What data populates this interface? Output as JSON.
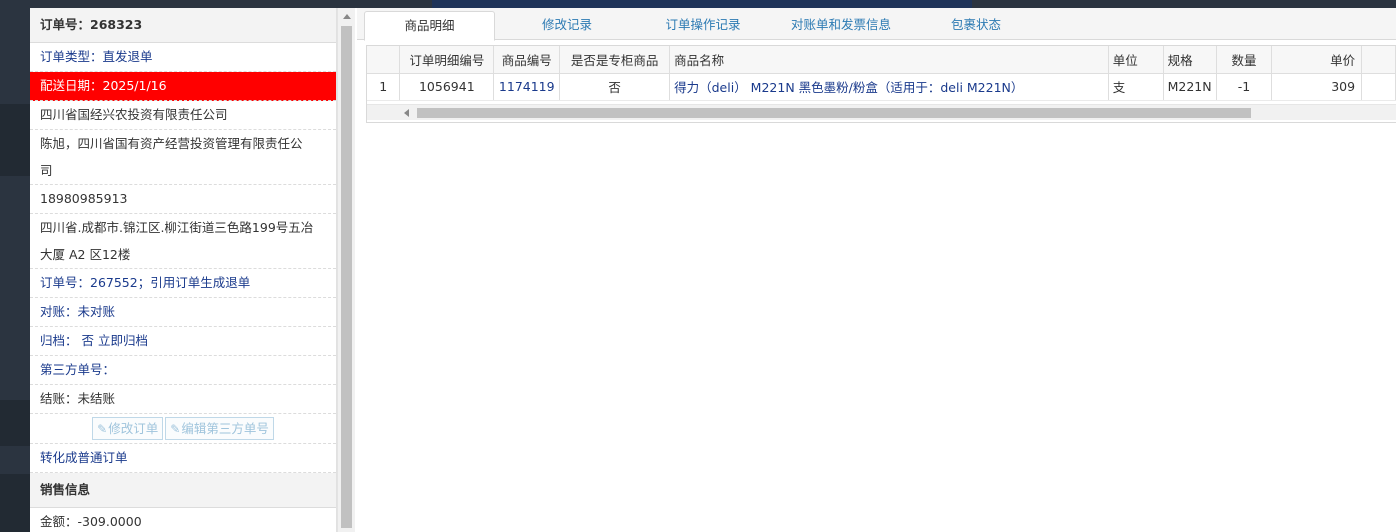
{
  "order": {
    "header": "订单号：268323",
    "type": "订单类型：直发退单",
    "delivery_date": "配送日期：2025/1/16",
    "company": "四川省国经兴农投资有限责任公司",
    "contact_line1": "陈旭，四川省国有资产经营投资管理有限责任公",
    "contact_line2": "司",
    "phone": "18980985913",
    "address_line1": "四川省.成都市.锦江区.柳江街道三色路199号五冶",
    "address_line2": "大厦 A2 区12楼",
    "ref_order": "订单号：267552；引用订单生成退单",
    "reconcile": "对账：未对账",
    "archive_label": "归档：",
    "archive_value": "否",
    "archive_link": "立即归档",
    "third_party": "第三方单号：",
    "settle": "结账：未结账",
    "btn_modify": "修改订单",
    "btn_edit_third": "编辑第三方单号",
    "convert_link": "转化成普通订单",
    "sales_header": "销售信息",
    "amount": "金额：-309.0000"
  },
  "tabs": [
    {
      "label": "商品明细",
      "active": true
    },
    {
      "label": "修改记录",
      "active": false
    },
    {
      "label": "订单操作记录",
      "active": false
    },
    {
      "label": "对账单和发票信息",
      "active": false
    },
    {
      "label": "包裹状态",
      "active": false
    }
  ],
  "table": {
    "columns": [
      "",
      "订单明细编号",
      "商品编号",
      "是否是专柜商品",
      "商品名称",
      "单位",
      "规格",
      "数量",
      "单价"
    ],
    "rows": [
      {
        "index": "1",
        "detail_id": "1056941",
        "product_id": "1174119",
        "is_counter": "否",
        "name": "得力（deli） M221N 黑色墨粉/粉盒（适用于：deli M221N）",
        "unit": "支",
        "spec": "M221N",
        "qty": "-1",
        "price": "309"
      }
    ]
  },
  "colors": {
    "accent_red": "#ff0000",
    "link_blue": "#1a3a8c",
    "tab_blue": "#2c7ab3"
  }
}
